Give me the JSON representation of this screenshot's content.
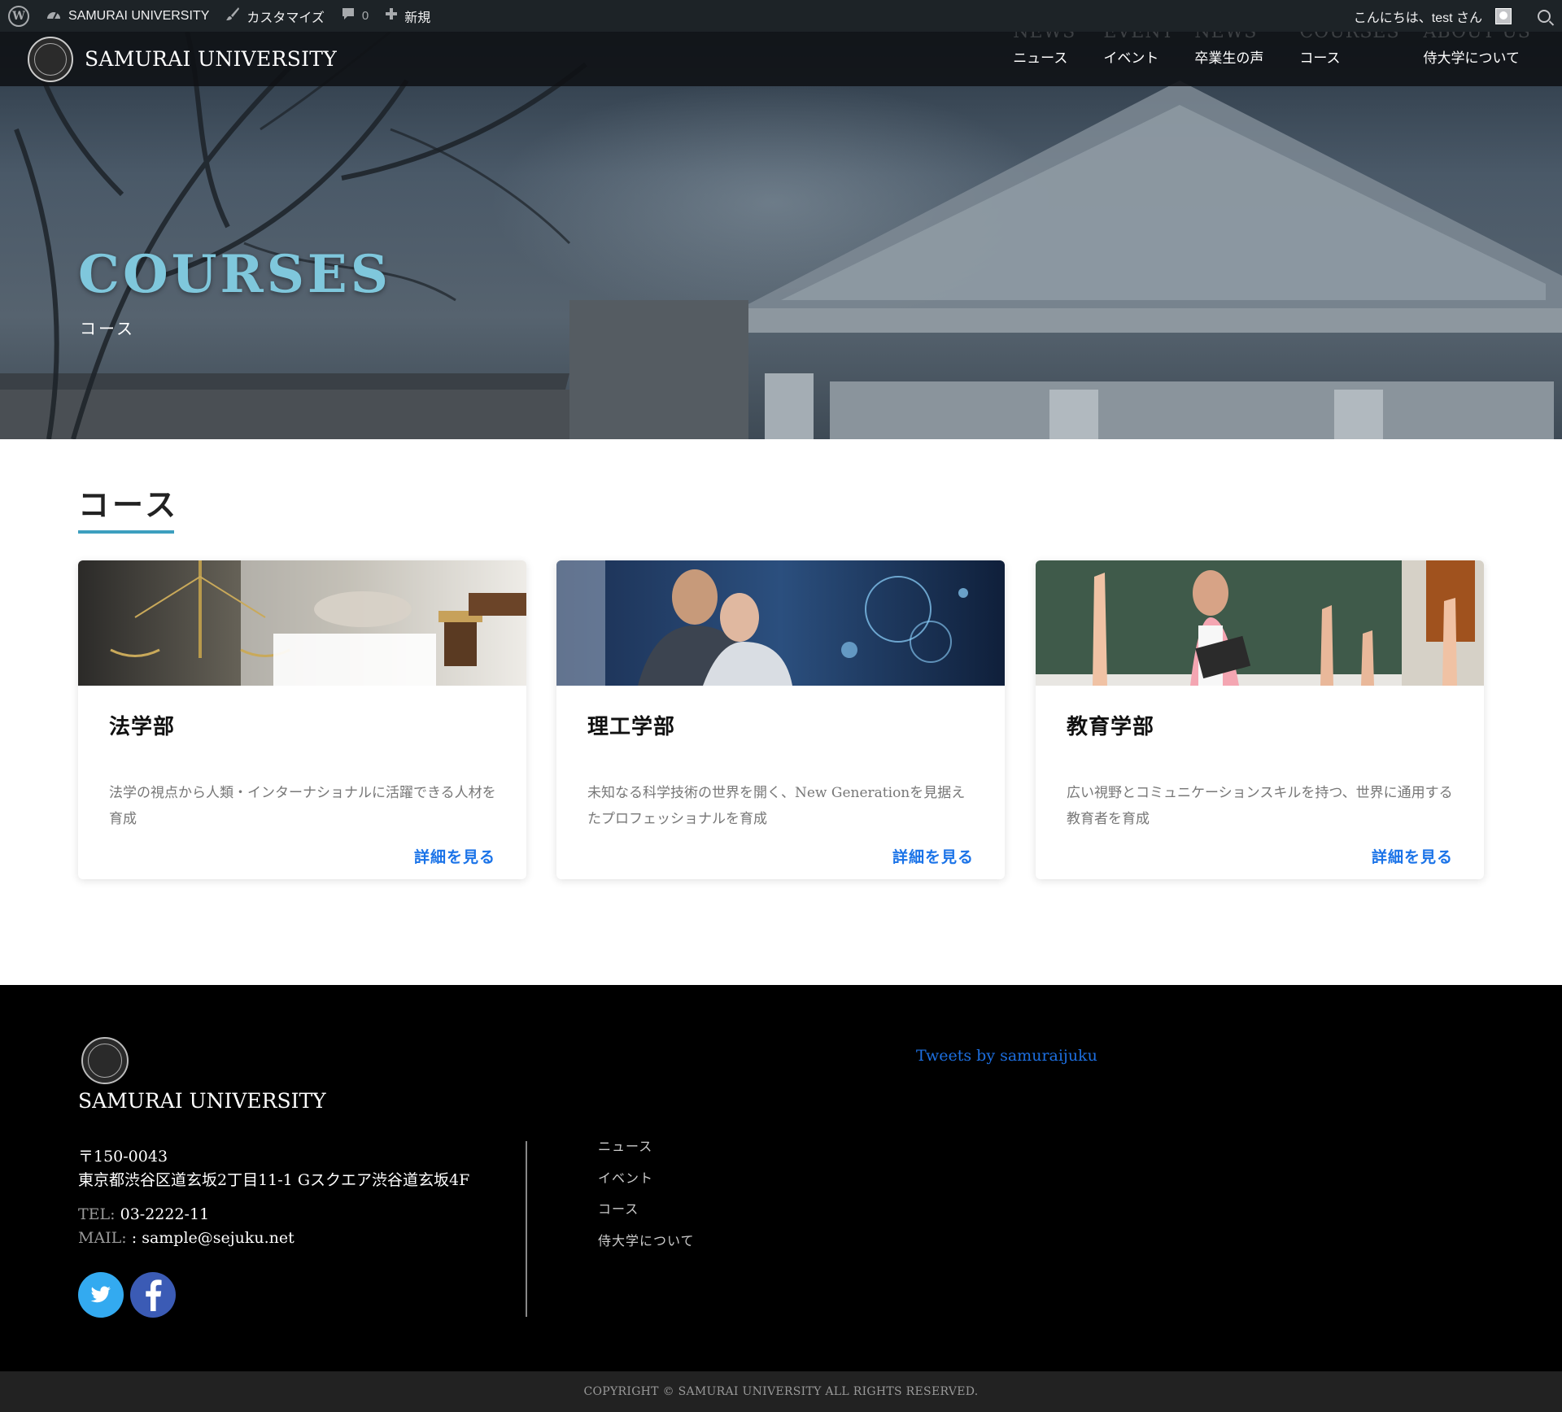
{
  "adminbar": {
    "site_name": "SAMURAI UNIVERSITY",
    "customize": "カスタマイズ",
    "comments_count": "0",
    "new_label": "新規",
    "greeting": "こんにちは、test さん"
  },
  "header": {
    "site_title": "SAMURAI UNIVERSITY",
    "nav": [
      {
        "en": "NEWS",
        "ja": "ニュース"
      },
      {
        "en": "EVENT",
        "ja": "イベント"
      },
      {
        "en": "NEWS",
        "ja": "卒業生の声"
      },
      {
        "en": "COURSES",
        "ja": "コース"
      },
      {
        "en": "ABOUT US",
        "ja": "侍大学について"
      }
    ]
  },
  "hero": {
    "title": "COURSES",
    "subtitle": "コース"
  },
  "section": {
    "heading": "コース"
  },
  "courses": [
    {
      "title": "法学部",
      "desc": "法学の視点から人類・インターナショナルに活躍できる人材を育成",
      "link": "詳細を見る"
    },
    {
      "title": "理工学部",
      "desc": "未知なる科学技術の世界を開く、New Generationを見据えたプロフェッショナルを育成",
      "link": "詳細を見る"
    },
    {
      "title": "教育学部",
      "desc": "広い視野とコミュニケーションスキルを持つ、世界に通用する教育者を育成",
      "link": "詳細を見る"
    }
  ],
  "footer": {
    "name": "SAMURAI UNIVERSITY",
    "postal": "〒150-0043",
    "address": "東京都渋谷区道玄坂2丁目11-1 Gスクエア渋谷道玄坂4F",
    "tel_label": "TEL:",
    "tel": "03-2222-11",
    "mail_label": "MAIL:",
    "mail": ": sample@sejuku.net",
    "nav": [
      "ニュース",
      "イベント",
      "コース",
      "侍大学について"
    ],
    "tweets_link": "Tweets by samuraijuku",
    "copyright": "COPYRIGHT © SAMURAI UNIVERSITY ALL RIGHTS RESERVED."
  },
  "colors": {
    "accent": "#3d9fbf",
    "hero_title": "#7fc7dc",
    "link": "#1a73e8",
    "twitter": "#33aaf0",
    "facebook": "#3b5bb5"
  }
}
